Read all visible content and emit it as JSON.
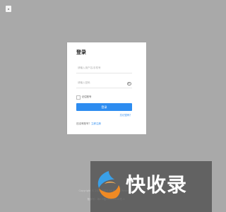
{
  "corner_logo": {
    "icon": "app-logo-icon"
  },
  "login": {
    "title": "登录",
    "username_placeholder": "请输入用户名/手机号",
    "password_placeholder": "请输入密码",
    "remember_label": "记住账号",
    "submit_label": "登录",
    "no_account_text": "还没有账号？",
    "register_link": "立即注册",
    "forgot_link": "忘记密码？"
  },
  "footer": {
    "line1": "Copyright © 2018-2021 All Rights Reserved",
    "line2": "备案号：粤ICP备XXXXXXXX号-1"
  },
  "watermark": {
    "text": "快收录",
    "colors": {
      "orange": "#f08a24",
      "blue": "#3aa0e8"
    }
  },
  "colors": {
    "primary": "#2d8cf0",
    "background": "#a9a9a9"
  }
}
